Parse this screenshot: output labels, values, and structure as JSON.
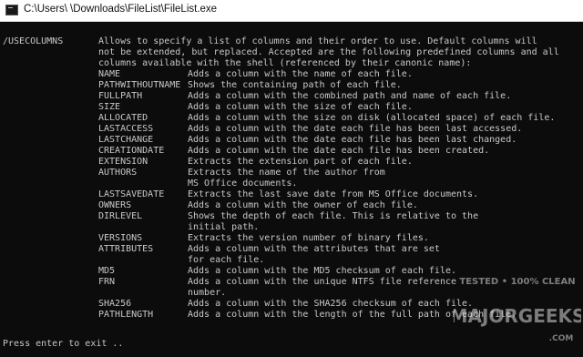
{
  "window": {
    "title_parts": [
      "C:\\Users\\",
      "\\Downloads\\FileList\\FileList.exe"
    ],
    "icon": "console-icon"
  },
  "console": {
    "lines": [
      [
        "",
        "",
        ""
      ],
      [
        "/USECOLUMNS",
        "Allows to specify a list of columns and their order to use. Default columns will",
        ""
      ],
      [
        "",
        "not be extended, but replaced. Accepted are the following predefined columns and all",
        ""
      ],
      [
        "",
        "columns available with the shell (referenced by their canonic name):",
        ""
      ],
      [
        "",
        "NAME",
        "Adds a column with the name of each file."
      ],
      [
        "",
        "PATHWITHOUTNAME",
        "Shows the containing path of each file."
      ],
      [
        "",
        "FULLPATH",
        "Adds a column with the combined path and name of each file."
      ],
      [
        "",
        "SIZE",
        "Adds a column with the size of each file."
      ],
      [
        "",
        "ALLOCATED",
        "Adds a column with the size on disk (allocated space) of each file."
      ],
      [
        "",
        "LASTACCESS",
        "Adds a column with the date each file has been last accessed."
      ],
      [
        "",
        "LASTCHANGE",
        "Adds a column with the date each file has been last changed."
      ],
      [
        "",
        "CREATIONDATE",
        "Adds a column with the date each file has been created."
      ],
      [
        "",
        "EXTENSION",
        "Extracts the extension part of each file."
      ],
      [
        "",
        "AUTHORS",
        "Extracts the name of the author from"
      ],
      [
        "",
        "",
        "MS Office documents."
      ],
      [
        "",
        "LASTSAVEDATE",
        "Extracts the last save date from MS Office documents."
      ],
      [
        "",
        "OWNERS",
        "Adds a column with the owner of each file."
      ],
      [
        "",
        "DIRLEVEL",
        "Shows the depth of each file. This is relative to the"
      ],
      [
        "",
        "",
        "initial path."
      ],
      [
        "",
        "VERSIONS",
        "Extracts the version number of binary files."
      ],
      [
        "",
        "ATTRIBUTES",
        "Adds a column with the attributes that are set"
      ],
      [
        "",
        "",
        "for each file."
      ],
      [
        "",
        "MD5",
        "Adds a column with the MD5 checksum of each file."
      ],
      [
        "",
        "FRN",
        "Adds a column with the unique NTFS file reference"
      ],
      [
        "",
        "",
        "number."
      ],
      [
        "",
        "SHA256",
        "Adds a column with the SHA256 checksum of each file."
      ],
      [
        "",
        "PATHLENGTH",
        "Adds a column with the length of the full path of each file."
      ]
    ],
    "prompt": "Press enter to exit .."
  },
  "watermark": {
    "line1": "TESTED • 100% CLEAN",
    "line2": "MAJORGEEKS",
    "line3": ".COM"
  }
}
